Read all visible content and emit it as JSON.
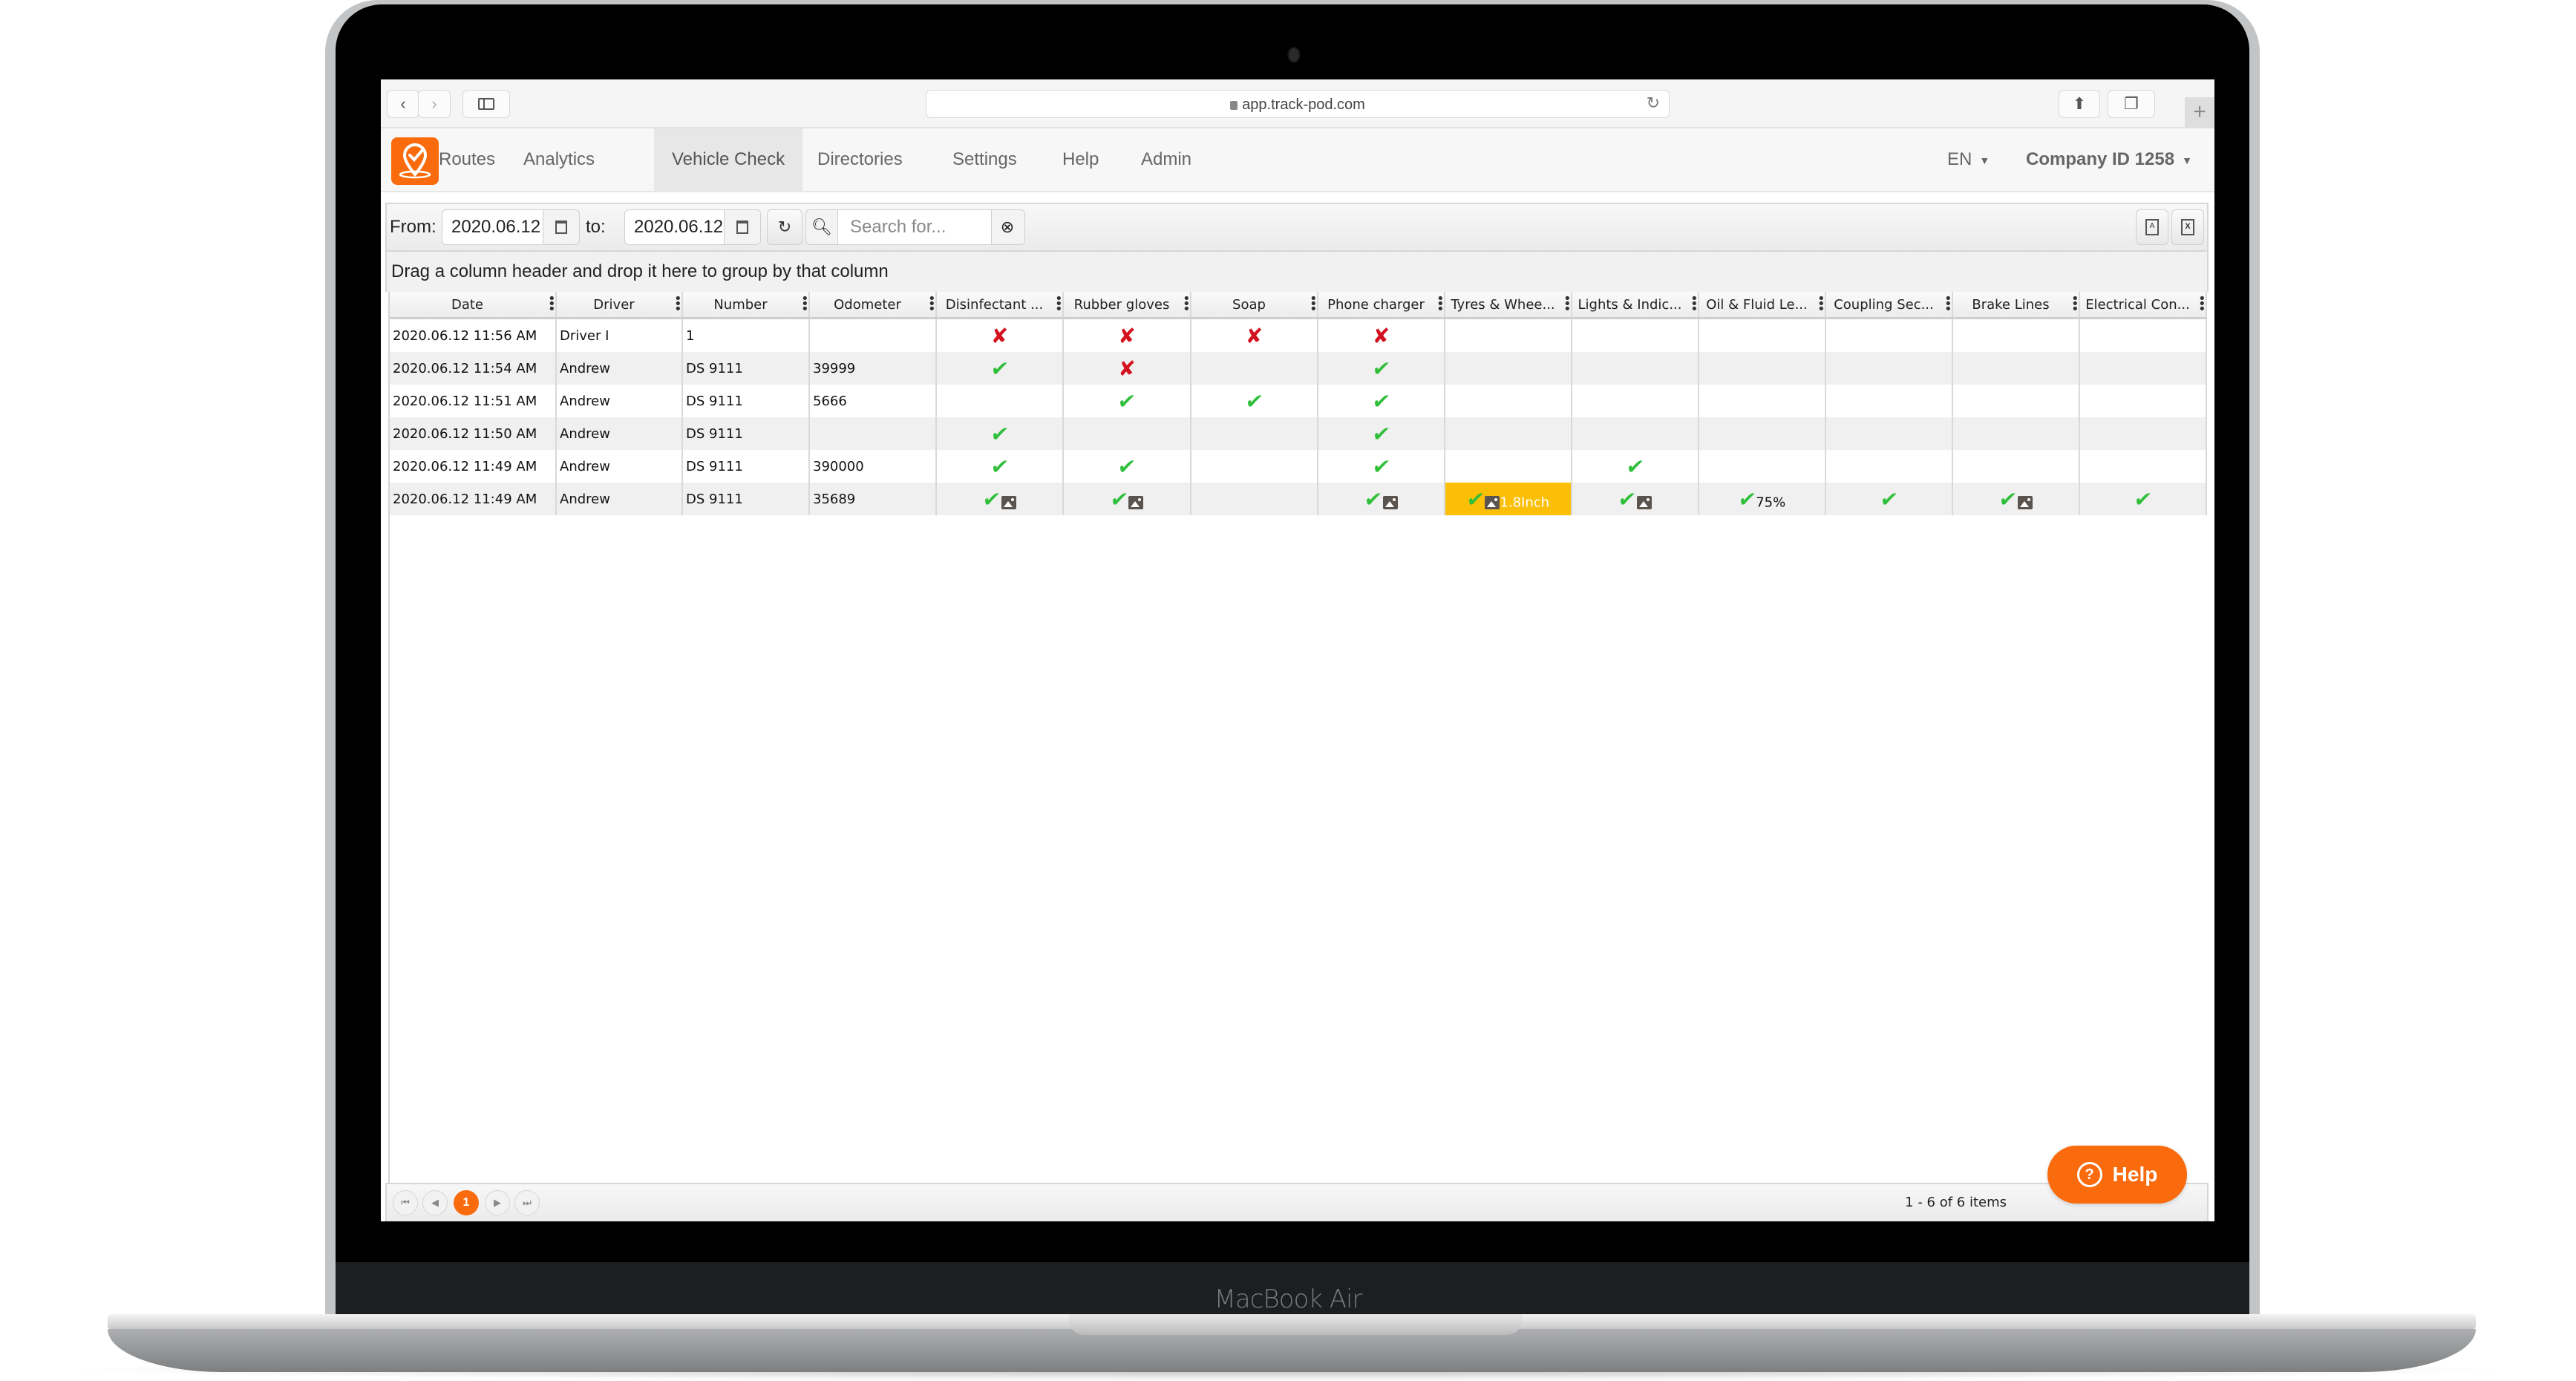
{
  "device": {
    "brand_label": "MacBook Air"
  },
  "browser": {
    "url": "app.track-pod.com",
    "back_icon": "chevron-left-icon",
    "forward_icon": "chevron-right-icon",
    "sidebar_icon": "sidebar-icon",
    "reload_icon": "reload-icon",
    "share_icon": "share-icon",
    "tabs_icon": "tabs-icon",
    "new_tab_label": "+"
  },
  "nav": {
    "items": [
      {
        "label": "Routes",
        "active": false
      },
      {
        "label": "Analytics",
        "active": false
      },
      {
        "label": "Vehicle Check",
        "active": true
      },
      {
        "label": "Directories",
        "active": false
      },
      {
        "label": "Settings",
        "active": false
      },
      {
        "label": "Help",
        "active": false
      },
      {
        "label": "Admin",
        "active": false
      }
    ],
    "language": "EN",
    "company": "Company ID 1258",
    "accent_color": "#f96b0c"
  },
  "toolbar": {
    "from_label": "From:",
    "from_value": "2020.06.12",
    "to_label": "to:",
    "to_value": "2020.06.12",
    "search_placeholder": "Search for...",
    "search_value": ""
  },
  "group_hint": "Drag a column header and drop it here to group by that column",
  "grid": {
    "columns": [
      "Date",
      "Driver",
      "Number",
      "Odometer",
      "Disinfectant ...",
      "Rubber gloves",
      "Soap",
      "Phone charger",
      "Tyres & Whee...",
      "Lights & Indic...",
      "Oil & Fluid Le...",
      "Coupling Sec...",
      "Brake Lines",
      "Electrical Con..."
    ],
    "rows": [
      {
        "date": "2020.06.12 11:56 AM",
        "driver": "Driver I",
        "number": "1",
        "odometer": "",
        "checks": [
          {
            "s": "fail"
          },
          {
            "s": "fail"
          },
          {
            "s": "fail"
          },
          {
            "s": "fail"
          },
          {
            "s": ""
          },
          {
            "s": ""
          },
          {
            "s": ""
          },
          {
            "s": ""
          },
          {
            "s": ""
          },
          {
            "s": ""
          }
        ]
      },
      {
        "date": "2020.06.12 11:54 AM",
        "driver": "Andrew",
        "number": "DS 9111",
        "odometer": "39999",
        "checks": [
          {
            "s": "ok"
          },
          {
            "s": "fail"
          },
          {
            "s": ""
          },
          {
            "s": "ok"
          },
          {
            "s": ""
          },
          {
            "s": ""
          },
          {
            "s": ""
          },
          {
            "s": ""
          },
          {
            "s": ""
          },
          {
            "s": ""
          }
        ]
      },
      {
        "date": "2020.06.12 11:51 AM",
        "driver": "Andrew",
        "number": "DS 9111",
        "odometer": "5666",
        "checks": [
          {
            "s": ""
          },
          {
            "s": "ok"
          },
          {
            "s": "ok"
          },
          {
            "s": "ok"
          },
          {
            "s": ""
          },
          {
            "s": ""
          },
          {
            "s": ""
          },
          {
            "s": ""
          },
          {
            "s": ""
          },
          {
            "s": ""
          }
        ]
      },
      {
        "date": "2020.06.12 11:50 AM",
        "driver": "Andrew",
        "number": "DS 9111",
        "odometer": "",
        "checks": [
          {
            "s": "ok"
          },
          {
            "s": ""
          },
          {
            "s": ""
          },
          {
            "s": "ok"
          },
          {
            "s": ""
          },
          {
            "s": ""
          },
          {
            "s": ""
          },
          {
            "s": ""
          },
          {
            "s": ""
          },
          {
            "s": ""
          }
        ]
      },
      {
        "date": "2020.06.12 11:49 AM",
        "driver": "Andrew",
        "number": "DS 9111",
        "odometer": "390000",
        "checks": [
          {
            "s": "ok"
          },
          {
            "s": "ok"
          },
          {
            "s": ""
          },
          {
            "s": "ok"
          },
          {
            "s": ""
          },
          {
            "s": "ok"
          },
          {
            "s": ""
          },
          {
            "s": ""
          },
          {
            "s": ""
          },
          {
            "s": ""
          }
        ]
      },
      {
        "date": "2020.06.12 11:49 AM",
        "driver": "Andrew",
        "number": "DS 9111",
        "odometer": "35689",
        "checks": [
          {
            "s": "ok",
            "photo": true
          },
          {
            "s": "ok",
            "photo": true
          },
          {
            "s": ""
          },
          {
            "s": "ok",
            "photo": true
          },
          {
            "s": "ok",
            "photo": true,
            "note": "1.8Inch",
            "warn": true
          },
          {
            "s": "ok",
            "photo": true
          },
          {
            "s": "ok",
            "note": "75%"
          },
          {
            "s": "ok"
          },
          {
            "s": "ok",
            "photo": true
          },
          {
            "s": "ok"
          }
        ]
      }
    ],
    "status_colors": {
      "ok": "#2fbf3a",
      "fail": "#d4121f",
      "warning": "#fbbf07"
    }
  },
  "pager": {
    "current_page": "1",
    "info": "1 - 6 of 6 items"
  },
  "help_button": {
    "label": "Help"
  }
}
